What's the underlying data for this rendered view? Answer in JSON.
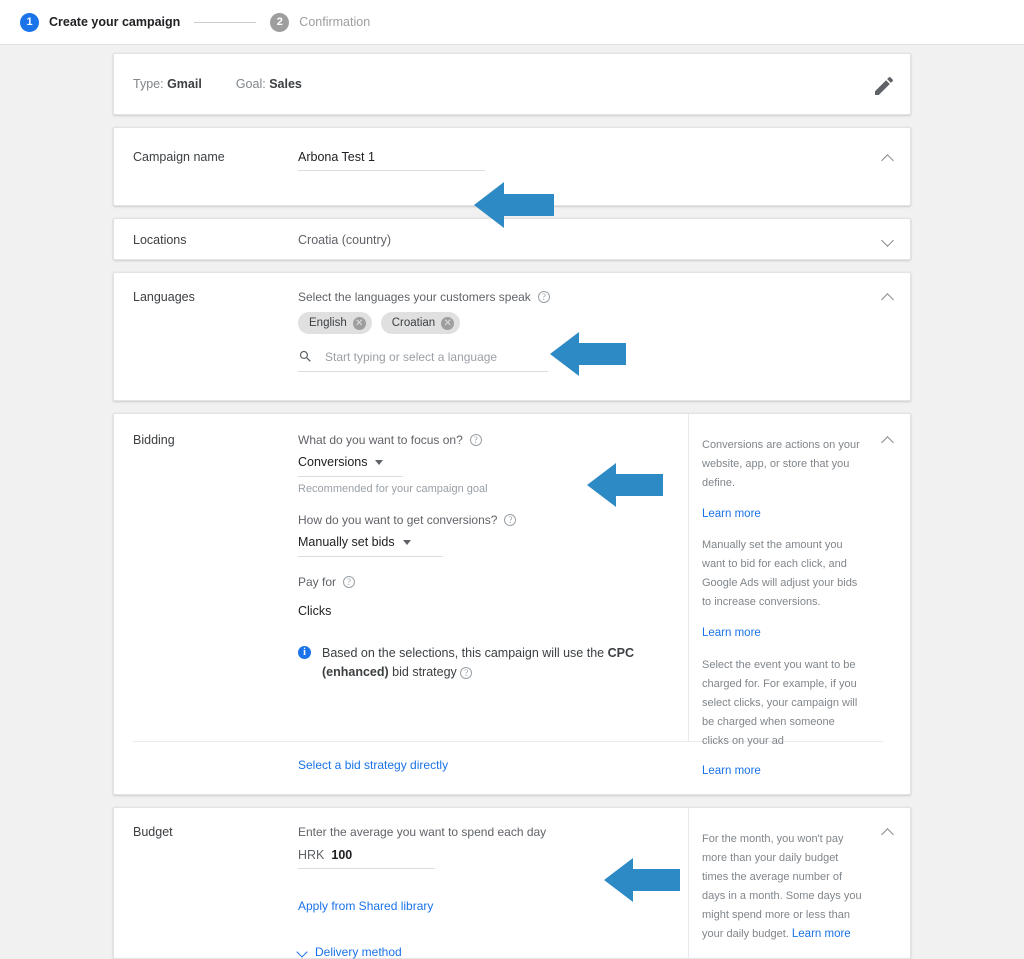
{
  "stepper": {
    "steps": [
      {
        "num": "1",
        "label": "Create your campaign",
        "state": "active"
      },
      {
        "num": "2",
        "label": "Confirmation",
        "state": "inactive"
      }
    ]
  },
  "colors": {
    "accent_blue": "#1a73e8",
    "arrow_blue": "#2e8ac4",
    "background": "#f1f1f1",
    "card": "#ffffff",
    "chip": "#e0e0e0"
  },
  "type_goal_card": {
    "type_label": "Type:",
    "type_value": "Gmail",
    "goal_label": "Goal:",
    "goal_value": "Sales",
    "edit_icon": "pencil-icon"
  },
  "campaign_name_card": {
    "label": "Campaign name",
    "value": "Arbona Test 1",
    "chevron": "chevron-up-icon"
  },
  "locations_card": {
    "label": "Locations",
    "value": "Croatia (country)",
    "chevron": "chevron-down-icon"
  },
  "languages_card": {
    "label": "Languages",
    "prompt": "Select the languages your customers speak",
    "chips": [
      {
        "label": "English",
        "remove": "✕"
      },
      {
        "label": "Croatian",
        "remove": "✕"
      }
    ],
    "search_placeholder": "Start typing or select a language",
    "search_icon": "search-icon",
    "chevron": "chevron-up-icon"
  },
  "bidding_card": {
    "label": "Bidding",
    "focus_question": "What do you want to focus on?",
    "focus_value": "Conversions",
    "focus_note": "Recommended for your campaign goal",
    "conversions_question": "How do you want to get conversions?",
    "conversions_value": "Manually set bids",
    "pay_for_label": "Pay for",
    "pay_for_value": "Clicks",
    "info_text_1": "Based on the selections, this campaign will use the ",
    "info_strong": "CPC (enhanced)",
    "info_text_2": " bid strategy",
    "footer_link": "Select a bid strategy directly",
    "help": {
      "p1": "Conversions are actions on your website, app, or store that you define.",
      "link1": "Learn more",
      "p2": "Manually set the amount you want to bid for each click, and Google Ads will adjust your bids to increase conversions.",
      "link2": "Learn more",
      "p3": "Select the event you want to be charged for. For example, if you select clicks, your campaign will be charged when someone clicks on your ad",
      "link3": "Learn more",
      "chevron": "chevron-up-icon"
    }
  },
  "budget_card": {
    "label": "Budget",
    "prompt": "Enter the average you want to spend each day",
    "currency": "HRK",
    "amount": "100",
    "shared_library_link": "Apply from Shared library",
    "delivery_method": "Delivery method",
    "delivery_chevron": "chevron-down-icon",
    "help": {
      "p1": "For the month, you won't pay more than your daily budget times the average number of days in a month. Some days you might spend more or less than your daily budget. ",
      "link1": "Learn more",
      "chevron": "chevron-up-icon"
    }
  },
  "annotations": {
    "arrows": [
      {
        "name": "arrow-campaign-name",
        "target": "campaign name field"
      },
      {
        "name": "arrow-languages",
        "target": "language chips"
      },
      {
        "name": "arrow-bidding-focus",
        "target": "focus dropdown"
      },
      {
        "name": "arrow-budget",
        "target": "budget amount field"
      }
    ]
  }
}
